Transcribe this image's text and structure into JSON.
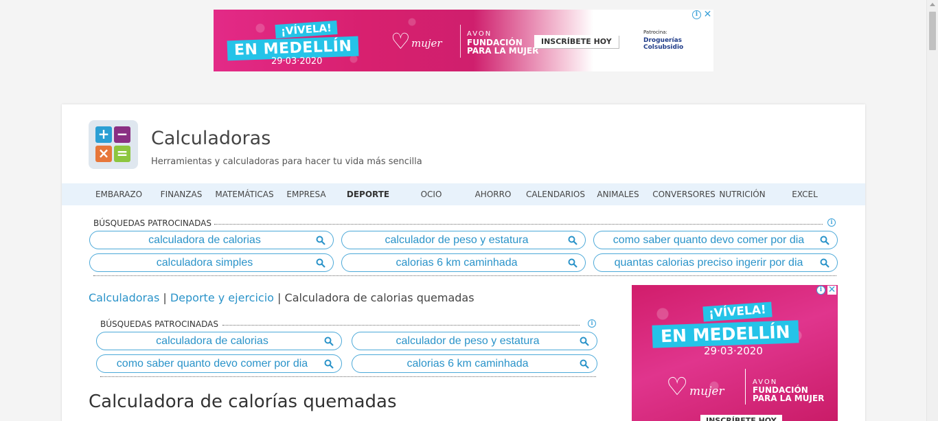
{
  "ad_banner": {
    "headline_top": "¡VÍVELA!",
    "headline_main": "EN MEDELLÍN",
    "date": "29·03·2020",
    "brand": "mujer",
    "avon": "AVON",
    "fundacion_line1": "FUNDACIÓN",
    "fundacion_line2": "PARA LA MUJER",
    "cta": "INSCRÍBETE HOY",
    "sponsor_label": "Patrocina:",
    "sponsor_name": "Droguerías Colsubsidio"
  },
  "header": {
    "title": "Calculadoras",
    "tagline": "Herramientas y calculadoras para hacer tu vida más sencilla",
    "logo_symbols": [
      "+",
      "−",
      "×",
      "="
    ]
  },
  "nav": {
    "items": [
      {
        "label": "EMBARAZO"
      },
      {
        "label": "FINANZAS"
      },
      {
        "label": "MATEMÁTICAS"
      },
      {
        "label": "EMPRESA"
      },
      {
        "label": "DEPORTE",
        "active": true
      },
      {
        "label": "OCIO"
      },
      {
        "label": "AHORRO"
      },
      {
        "label": "CALENDARIOS"
      },
      {
        "label": "ANIMALES"
      },
      {
        "label": "CONVERSORES"
      },
      {
        "label": "NUTRICIÓN"
      },
      {
        "label": "EXCEL"
      }
    ]
  },
  "sponsored_top": {
    "label": "BÚSQUEDAS PATROCINADAS",
    "searches": [
      "calculadora de calorias",
      "calculador de peso y estatura",
      "como saber quanto devo comer por dia",
      "calculadora simples",
      "calorias 6 km caminhada",
      "quantas calorias preciso ingerir por dia"
    ]
  },
  "breadcrumb": {
    "home": "Calculadoras",
    "category": "Deporte y ejercicio",
    "current": "Calculadora de calorias quemadas",
    "separator": "|"
  },
  "sponsored_inline": {
    "label": "BÚSQUEDAS PATROCINADAS",
    "searches": [
      "calculadora de calorias",
      "calculador de peso y estatura",
      "como saber quanto devo comer por dia",
      "calorias 6 km caminhada"
    ]
  },
  "page": {
    "title": "Calculadora de calorías quemadas"
  },
  "ad_side": {
    "headline_top": "¡VÍVELA!",
    "headline_main": "EN MEDELLÍN",
    "date": "29·03·2020",
    "brand": "mujer",
    "avon": "AVON",
    "fundacion_line1": "FUNDACIÓN",
    "fundacion_line2": "PARA LA MUJER",
    "cta": "INSCRÍBETE HOY"
  },
  "colors": {
    "accent": "#2a93c9",
    "nav_bg": "#e8f2fb",
    "ad_pink": "#d8206f",
    "ad_cyan": "#25c3e8"
  }
}
